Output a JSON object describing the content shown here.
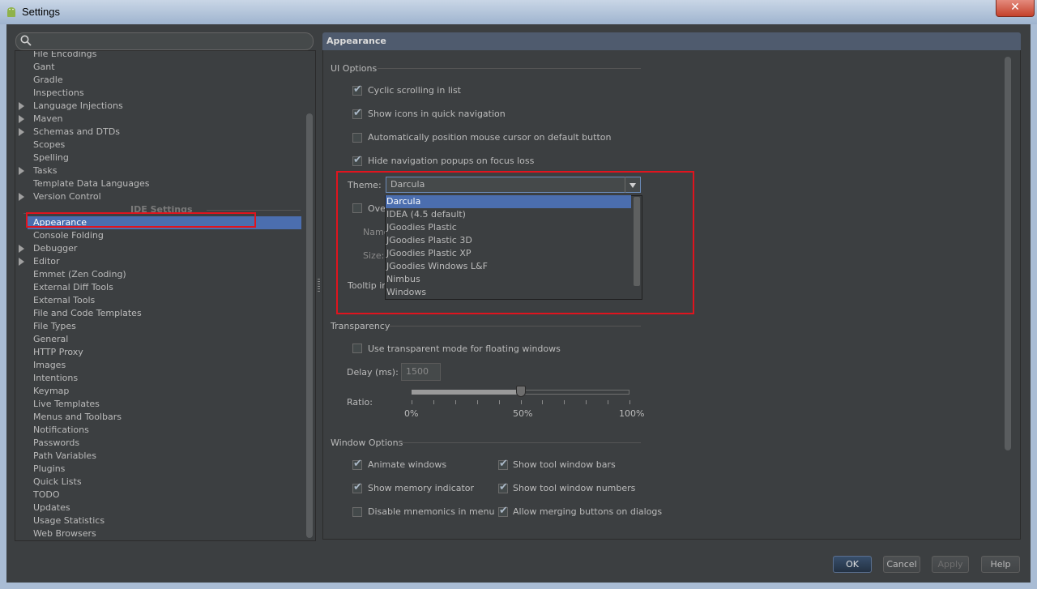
{
  "window": {
    "title": "Settings",
    "close_glyph": "✕"
  },
  "sidebar": {
    "search_placeholder": "",
    "items_top": [
      {
        "label": "File Encodings",
        "expandable": false
      },
      {
        "label": "Gant",
        "expandable": false
      },
      {
        "label": "Gradle",
        "expandable": false
      },
      {
        "label": "Inspections",
        "expandable": false
      },
      {
        "label": "Language Injections",
        "expandable": true
      },
      {
        "label": "Maven",
        "expandable": true
      },
      {
        "label": "Schemas and DTDs",
        "expandable": true
      },
      {
        "label": "Scopes",
        "expandable": false
      },
      {
        "label": "Spelling",
        "expandable": false
      },
      {
        "label": "Tasks",
        "expandable": true
      },
      {
        "label": "Template Data Languages",
        "expandable": false
      },
      {
        "label": "Version Control",
        "expandable": true
      }
    ],
    "section_label": "IDE Settings",
    "selected_label": "Appearance",
    "items_bottom": [
      {
        "label": "Console Folding",
        "expandable": false
      },
      {
        "label": "Debugger",
        "expandable": true
      },
      {
        "label": "Editor",
        "expandable": true
      },
      {
        "label": "Emmet (Zen Coding)",
        "expandable": false
      },
      {
        "label": "External Diff Tools",
        "expandable": false
      },
      {
        "label": "External Tools",
        "expandable": false
      },
      {
        "label": "File and Code Templates",
        "expandable": false
      },
      {
        "label": "File Types",
        "expandable": false
      },
      {
        "label": "General",
        "expandable": false
      },
      {
        "label": "HTTP Proxy",
        "expandable": false
      },
      {
        "label": "Images",
        "expandable": false
      },
      {
        "label": "Intentions",
        "expandable": false
      },
      {
        "label": "Keymap",
        "expandable": false
      },
      {
        "label": "Live Templates",
        "expandable": false
      },
      {
        "label": "Menus and Toolbars",
        "expandable": false
      },
      {
        "label": "Notifications",
        "expandable": false
      },
      {
        "label": "Passwords",
        "expandable": false
      },
      {
        "label": "Path Variables",
        "expandable": false
      },
      {
        "label": "Plugins",
        "expandable": false
      },
      {
        "label": "Quick Lists",
        "expandable": false
      },
      {
        "label": "TODO",
        "expandable": false
      },
      {
        "label": "Updates",
        "expandable": false
      },
      {
        "label": "Usage Statistics",
        "expandable": false
      },
      {
        "label": "Web Browsers",
        "expandable": false
      }
    ]
  },
  "panel": {
    "title": "Appearance",
    "ui_options": {
      "title": "UI Options",
      "checkboxes": [
        {
          "label": "Cyclic scrolling in list",
          "checked": true
        },
        {
          "label": "Show icons in quick navigation",
          "checked": true
        },
        {
          "label": "Automatically position mouse cursor on default button",
          "checked": false
        },
        {
          "label": "Hide navigation popups on focus loss",
          "checked": true
        }
      ],
      "theme_label": "Theme:",
      "theme_value": "Darcula",
      "theme_options": [
        "Darcula",
        "IDEA (4.5 default)",
        "JGoodies Plastic",
        "JGoodies Plastic 3D",
        "JGoodies Plastic XP",
        "JGoodies Windows L&F",
        "Nimbus",
        "Windows"
      ],
      "override_fonts_label_partial": "Ove",
      "name_label_partial": "Name",
      "size_label_partial": "Size:",
      "tooltip_label_partial": "Tooltip ini"
    },
    "transparency": {
      "title": "Transparency",
      "use_transparent_label": "Use transparent mode for floating windows",
      "use_transparent_checked": false,
      "delay_label": "Delay (ms):",
      "delay_value": "1500",
      "ratio_label": "Ratio:",
      "ratio_value": 0.5,
      "tick_labels": [
        "0%",
        "50%",
        "100%"
      ]
    },
    "window_options": {
      "title": "Window Options",
      "left_column": [
        {
          "label": "Animate windows",
          "checked": true
        },
        {
          "label": "Show memory indicator",
          "checked": true
        },
        {
          "label": "Disable mnemonics in menu",
          "checked": false
        }
      ],
      "right_column": [
        {
          "label": "Show tool window bars",
          "checked": true
        },
        {
          "label": "Show tool window numbers",
          "checked": true
        },
        {
          "label": "Allow merging buttons on dialogs",
          "checked": true
        }
      ]
    }
  },
  "buttons": {
    "ok": "OK",
    "cancel": "Cancel",
    "apply": "Apply",
    "help": "Help"
  },
  "colors": {
    "background": "#3c3f41",
    "selection": "#4b6eaf",
    "highlight_border": "#e0141e"
  }
}
